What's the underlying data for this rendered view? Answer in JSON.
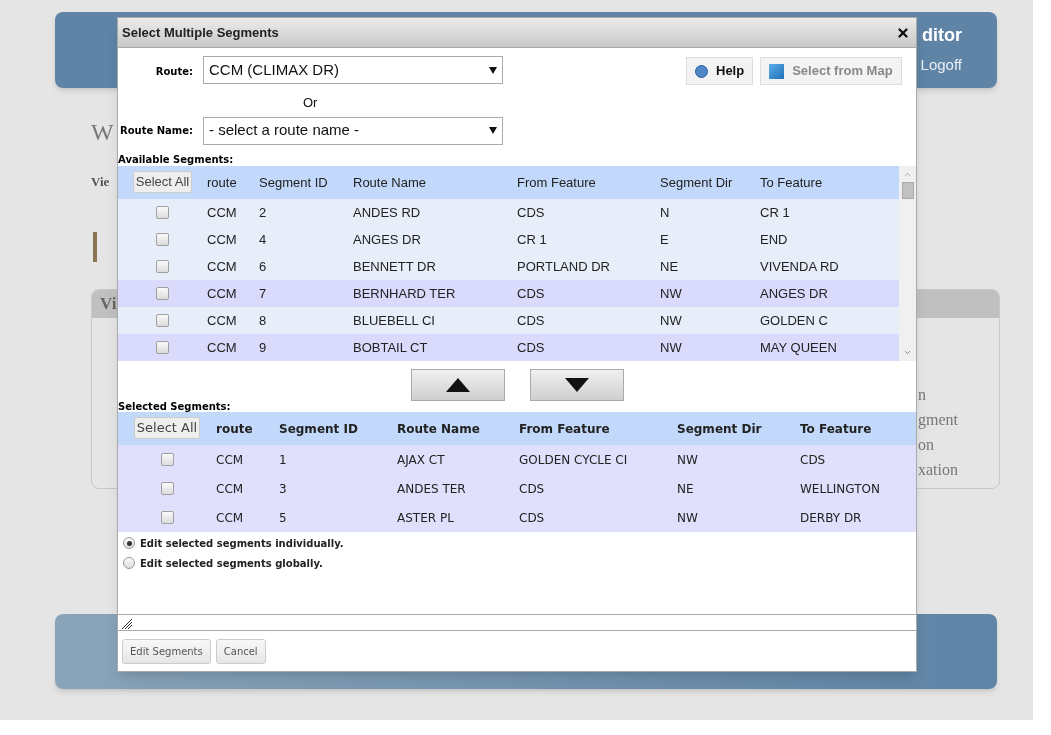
{
  "background_page": {
    "header_title": "ditor",
    "logoff": "Logoff",
    "heading": "W",
    "view_link": "Vie",
    "panel_title": "Vi",
    "panel_items": [
      "n",
      "gment",
      "on",
      "xation"
    ]
  },
  "dialog": {
    "title": "Select Multiple Segments",
    "route": {
      "label": "Route:",
      "value": "CCM (CLIMAX DR)"
    },
    "or_text": "Or",
    "route_name": {
      "label": "Route Name:",
      "value": "- select a route name -"
    },
    "help_button": "Help",
    "map_button": "Select from Map",
    "available": {
      "label": "Available Segments:",
      "select_all": "Select All",
      "columns": [
        "route",
        "Segment ID",
        "Route Name",
        "From Feature",
        "Segment Dir",
        "To Feature"
      ],
      "rows": [
        {
          "cells": [
            "CCM",
            "2",
            "ANDES RD",
            "CDS",
            "N",
            "CR 1"
          ],
          "checked": false,
          "shaded": false
        },
        {
          "cells": [
            "CCM",
            "4",
            "ANGES DR",
            "CR 1",
            "E",
            "END"
          ],
          "checked": false,
          "shaded": false
        },
        {
          "cells": [
            "CCM",
            "6",
            "BENNETT DR",
            "PORTLAND DR",
            "NE",
            "VIVENDA RD"
          ],
          "checked": false,
          "shaded": false
        },
        {
          "cells": [
            "CCM",
            "7",
            "BERNHARD TER",
            "CDS",
            "NW",
            "ANGES DR"
          ],
          "checked": false,
          "shaded": true
        },
        {
          "cells": [
            "CCM",
            "8",
            "BLUEBELL CI",
            "CDS",
            "NW",
            "GOLDEN C"
          ],
          "checked": false,
          "shaded": false
        },
        {
          "cells": [
            "CCM",
            "9",
            "BOBTAIL CT",
            "CDS",
            "NW",
            "MAY QUEEN"
          ],
          "checked": false,
          "shaded": true
        }
      ]
    },
    "selected": {
      "label": "Selected Segments:",
      "select_all": "Select All",
      "columns": [
        "route",
        "Segment ID",
        "Route Name",
        "From Feature",
        "Segment Dir",
        "To Feature"
      ],
      "rows": [
        {
          "cells": [
            "CCM",
            "1",
            "AJAX CT",
            "GOLDEN CYCLE CI",
            "NW",
            "CDS"
          ],
          "checked": false
        },
        {
          "cells": [
            "CCM",
            "3",
            "ANDES TER",
            "CDS",
            "NE",
            "WELLINGTON"
          ],
          "checked": false
        },
        {
          "cells": [
            "CCM",
            "5",
            "ASTER PL",
            "CDS",
            "NW",
            "DERBY DR"
          ],
          "checked": false
        }
      ]
    },
    "edit_modes": [
      {
        "label": "Edit selected segments individually.",
        "selected": true
      },
      {
        "label": "Edit selected segments globally.",
        "selected": false
      }
    ],
    "footer_buttons": [
      "Edit Segments",
      "Cancel"
    ]
  }
}
